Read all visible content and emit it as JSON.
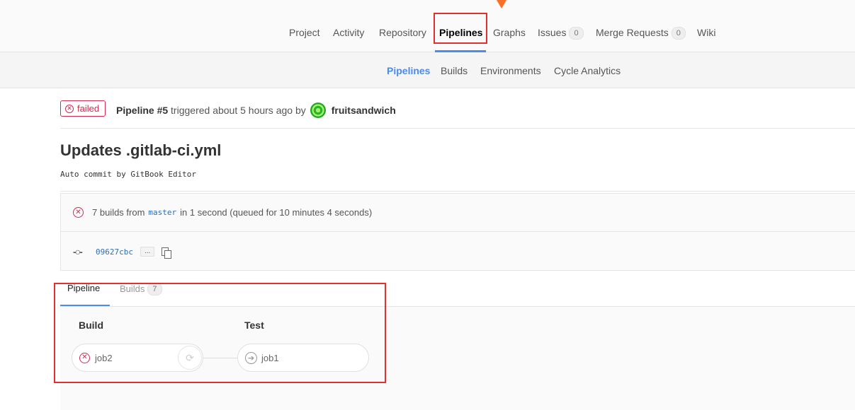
{
  "topnav": {
    "items": [
      {
        "label": "Project"
      },
      {
        "label": "Activity"
      },
      {
        "label": "Repository"
      },
      {
        "label": "Pipelines",
        "active": true
      },
      {
        "label": "Graphs"
      },
      {
        "label": "Issues",
        "count": "0"
      },
      {
        "label": "Merge Requests",
        "count": "0"
      },
      {
        "label": "Wiki"
      }
    ]
  },
  "subnav": {
    "items": [
      {
        "label": "Pipelines",
        "active": true
      },
      {
        "label": "Builds"
      },
      {
        "label": "Environments"
      },
      {
        "label": "Cycle Analytics"
      }
    ]
  },
  "pipeline": {
    "status": "failed",
    "name": "Pipeline #5",
    "trigger_text": "triggered about 5 hours ago by",
    "user": "fruitsandwich"
  },
  "commit": {
    "title": "Updates .gitlab-ci.yml",
    "description": "Auto commit by GitBook Editor",
    "sha": "09627cbc",
    "ellipsis": "...",
    "summary_prefix": "7 builds from",
    "branch": "master",
    "summary_suffix": "in 1 second (queued for 10 minutes 4 seconds)"
  },
  "tabs": {
    "pipeline": "Pipeline",
    "builds": "Builds",
    "builds_count": "7"
  },
  "graph": {
    "stages": [
      {
        "title": "Build",
        "jobs": [
          {
            "name": "job2",
            "status": "failed"
          }
        ]
      },
      {
        "title": "Test",
        "jobs": [
          {
            "name": "job1",
            "status": "skipped"
          }
        ]
      }
    ]
  },
  "colors": {
    "accent": "#4a8bee",
    "failed": "#d22852",
    "highlight": "#e03030",
    "logo": "#fc6d26"
  }
}
